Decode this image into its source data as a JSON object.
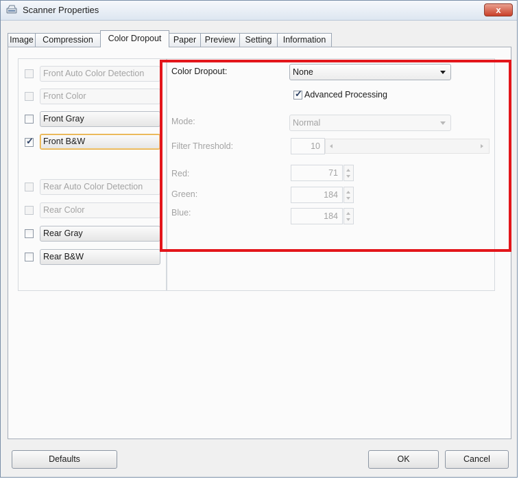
{
  "window": {
    "title": "Scanner Properties",
    "close_label": "x"
  },
  "tabs": [
    "Image",
    "Compression",
    "Color Dropout",
    "Paper",
    "Preview",
    "Setting",
    "Information"
  ],
  "active_tab": "Color Dropout",
  "left_list": {
    "front_auto": {
      "label": "Front Auto Color Detection",
      "checked": false,
      "enabled": false
    },
    "front_color": {
      "label": "Front Color",
      "checked": false,
      "enabled": false
    },
    "front_gray": {
      "label": "Front Gray",
      "checked": false,
      "enabled": true
    },
    "front_bw": {
      "label": "Front B&W",
      "checked": true,
      "enabled": true
    },
    "rear_auto": {
      "label": "Rear Auto Color Detection",
      "checked": false,
      "enabled": false
    },
    "rear_color": {
      "label": "Rear Color",
      "checked": false,
      "enabled": false
    },
    "rear_gray": {
      "label": "Rear Gray",
      "checked": false,
      "enabled": true
    },
    "rear_bw": {
      "label": "Rear B&W",
      "checked": false,
      "enabled": true
    }
  },
  "dropout": {
    "label": "Color Dropout:",
    "value": "None",
    "advanced_label": "Advanced Processing",
    "advanced_checked": true,
    "mode_label": "Mode:",
    "mode_value": "Normal",
    "threshold_label": "Filter Threshold:",
    "threshold_value": "10",
    "red_label": "Red:",
    "red_value": "71",
    "green_label": "Green:",
    "green_value": "184",
    "blue_label": "Blue:",
    "blue_value": "184"
  },
  "footer": {
    "defaults_label": "Defaults",
    "ok_label": "OK",
    "cancel_label": "Cancel"
  },
  "colors": {
    "highlight_border": "#e3161b",
    "focus_border": "#e3a73a"
  }
}
